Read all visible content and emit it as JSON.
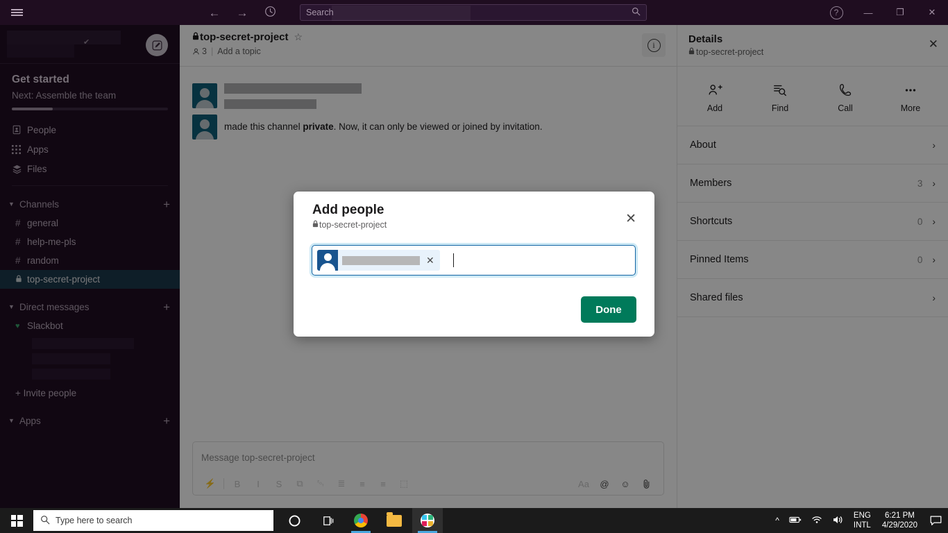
{
  "titlebar": {
    "back_icon": "←",
    "forward_icon": "→",
    "history_icon": "clock-icon",
    "search_placeholder": "Search",
    "help_label": "?",
    "minimize_label": "—",
    "maximize_label": "❐",
    "close_label": "✕"
  },
  "sidebar": {
    "get_started": {
      "title": "Get started",
      "next": "Next: Assemble the team",
      "progress_percent": 26
    },
    "nav": [
      {
        "label": "People",
        "icon": "people-icon"
      },
      {
        "label": "Apps",
        "icon": "apps-grid-icon"
      },
      {
        "label": "Files",
        "icon": "files-stack-icon"
      }
    ],
    "channels_group": {
      "label": "Channels",
      "add_label": "+",
      "items": [
        {
          "label": "general",
          "prefix": "#",
          "selected": false
        },
        {
          "label": "help-me-pls",
          "prefix": "#",
          "selected": false
        },
        {
          "label": "random",
          "prefix": "#",
          "selected": false
        },
        {
          "label": "top-secret-project",
          "prefix": " ",
          "selected": true
        }
      ]
    },
    "dm_group": {
      "label": "Direct messages",
      "add_label": "+",
      "items": [
        {
          "label": "Slackbot",
          "status": "heart"
        }
      ],
      "invite_label": "+ Invite people"
    },
    "apps_group": {
      "label": "Apps",
      "add_label": "+"
    }
  },
  "channel": {
    "name": "top-secret-project",
    "lock_icon": "lock-icon",
    "star_icon": "star-outline-icon",
    "member_count": "3",
    "topic_placeholder": "Add a topic",
    "info_icon": "info-icon"
  },
  "messages": [
    {
      "redacted": true,
      "text": ""
    },
    {
      "redacted": false,
      "text_before": "made this channel ",
      "text_bold": "private",
      "text_after": ". Now, it can only be viewed or joined by invitation."
    }
  ],
  "composer": {
    "placeholder": "Message top-secret-project",
    "tools": [
      {
        "name": "lightning-icon",
        "glyph": "⚡",
        "faded": false
      },
      {
        "name": "bold-icon",
        "glyph": "B",
        "faded": true
      },
      {
        "name": "italic-icon",
        "glyph": "I",
        "faded": true
      },
      {
        "name": "strikethrough-icon",
        "glyph": "S",
        "faded": true
      },
      {
        "name": "link-icon",
        "glyph": "⧉",
        "faded": true
      },
      {
        "name": "code-icon",
        "glyph": "␄",
        "faded": true
      },
      {
        "name": "ordered-list-icon",
        "glyph": "≣",
        "faded": true
      },
      {
        "name": "bulleted-list-icon",
        "glyph": "≡",
        "faded": true
      },
      {
        "name": "blockquote-icon",
        "glyph": "≡",
        "faded": true
      },
      {
        "name": "code-block-icon",
        "glyph": "⬚",
        "faded": true
      }
    ],
    "right_tools": [
      {
        "name": "format-icon",
        "glyph": "Aa",
        "faded": true
      },
      {
        "name": "mention-icon",
        "glyph": "@",
        "faded": false
      },
      {
        "name": "emoji-icon",
        "glyph": "☺",
        "faded": false
      },
      {
        "name": "attachment-icon",
        "glyph": "📎",
        "faded": false
      }
    ]
  },
  "details": {
    "title": "Details",
    "subtitle": "top-secret-project",
    "lock_icon": "lock-icon",
    "close_label": "✕",
    "actions": [
      {
        "label": "Add",
        "icon": "add-person-icon",
        "glyph": "☺+"
      },
      {
        "label": "Find",
        "icon": "find-icon",
        "glyph": "☰"
      },
      {
        "label": "Call",
        "icon": "phone-icon",
        "glyph": "✆"
      },
      {
        "label": "More",
        "icon": "more-dots-icon",
        "glyph": "⋯"
      }
    ],
    "rows": [
      {
        "label": "About",
        "count": ""
      },
      {
        "label": "Members",
        "count": "3"
      },
      {
        "label": "Shortcuts",
        "count": "0"
      },
      {
        "label": "Pinned Items",
        "count": "0"
      },
      {
        "label": "Shared files",
        "count": ""
      }
    ],
    "chevron": "›"
  },
  "modal": {
    "title": "Add people",
    "subtitle": "top-secret-project",
    "lock_icon": "lock-icon",
    "close_label": "✕",
    "pill": {
      "avatar_icon": "person-avatar-icon",
      "name_redacted": true,
      "remove_label": "✕"
    },
    "done_label": "Done"
  },
  "taskbar": {
    "start_icon": "windows-start-icon",
    "search_placeholder": "Type here to search",
    "search_icon": "search-icon",
    "cortana_icon": "cortana-circle-icon",
    "taskview_icon": "task-view-icon",
    "apps": [
      {
        "name": "chrome-icon",
        "active": true
      },
      {
        "name": "file-explorer-icon",
        "active": false
      },
      {
        "name": "slack-icon",
        "active": true
      }
    ],
    "tray": {
      "chevron_up": "^",
      "battery_icon": "battery-icon",
      "wifi_icon": "wifi-icon",
      "volume_icon": "volume-icon",
      "lang_line1": "ENG",
      "lang_line2": "INTL",
      "time": "6:21 PM",
      "date": "4/29/2020",
      "action_center_icon": "action-center-icon"
    }
  },
  "colors": {
    "sidebar_bg": "#210f23",
    "selected_channel": "#1c3a4c",
    "done_button": "#007a5a",
    "focus_border": "#1164a3",
    "avatar_blue": "#0f5f7a"
  }
}
